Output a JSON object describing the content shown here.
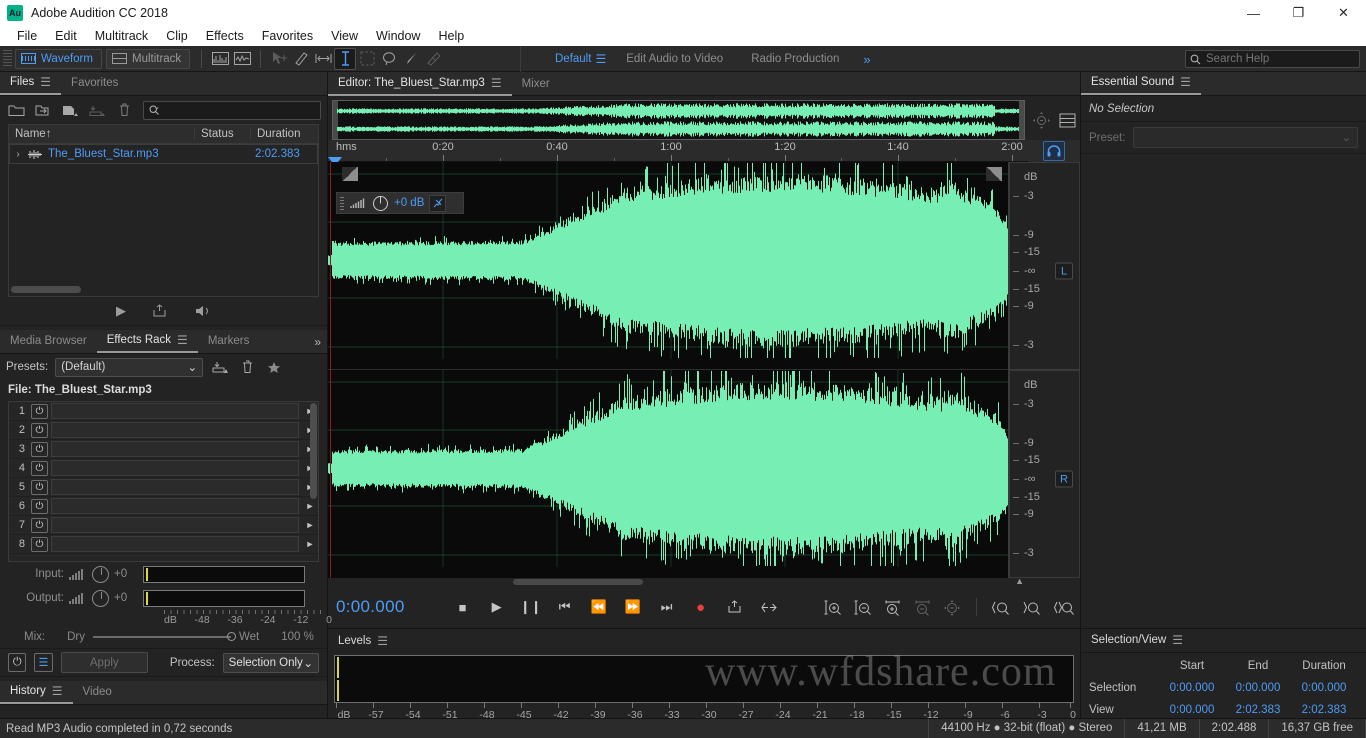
{
  "window": {
    "app_icon": "Au",
    "title": "Adobe Audition CC 2018",
    "minimize": "—",
    "maximize": "❐",
    "close": "✕"
  },
  "menubar": {
    "items": [
      "File",
      "Edit",
      "Multitrack",
      "Clip",
      "Effects",
      "Favorites",
      "View",
      "Window",
      "Help"
    ]
  },
  "toolbar": {
    "waveform_label": "Waveform",
    "multitrack_label": "Multitrack",
    "workspaces": [
      {
        "label": "Default",
        "active": true
      },
      {
        "label": "Edit Audio to Video",
        "active": false
      },
      {
        "label": "Radio Production",
        "active": false
      }
    ],
    "workspace_more": "»",
    "search_placeholder": "Search Help",
    "search_value": ""
  },
  "files_panel": {
    "tabs": [
      {
        "label": "Files",
        "active": true
      },
      {
        "label": "Favorites",
        "active": false
      }
    ],
    "search_placeholder": "",
    "search_value": "",
    "columns": {
      "name": "Name",
      "sort_arrow": "↑",
      "status": "Status",
      "duration": "Duration"
    },
    "rows": [
      {
        "expander": "›",
        "name": "The_Bluest_Star.mp3",
        "status": "",
        "duration": "2:02.383"
      }
    ],
    "transport": [
      "play-icon",
      "export-icon",
      "loop-play-icon"
    ]
  },
  "effects_panel": {
    "tabs": [
      {
        "label": "Media Browser",
        "active": false
      },
      {
        "label": "Effects Rack",
        "active": true
      },
      {
        "label": "Markers",
        "active": false
      }
    ],
    "more": "»",
    "presets_label": "Presets:",
    "presets_value": "(Default)",
    "file_label": "File: The_Bluest_Star.mp3",
    "slots": [
      "1",
      "2",
      "3",
      "4",
      "5",
      "6",
      "7",
      "8"
    ],
    "input_label": "Input:",
    "input_value": "+0",
    "output_label": "Output:",
    "output_value": "+0",
    "meter_scale": [
      "dB",
      "-48",
      "-36",
      "-24",
      "-12",
      "0"
    ],
    "mix_label": "Mix:",
    "mix_dry": "Dry",
    "mix_wet": "Wet",
    "mix_percent": "100 %",
    "apply_label": "Apply",
    "process_label": "Process:",
    "process_value": "Selection Only"
  },
  "history_panel": {
    "tabs": [
      {
        "label": "History",
        "active": true
      },
      {
        "label": "Video",
        "active": false
      }
    ]
  },
  "editor": {
    "tabs": [
      {
        "label": "Editor: The_Bluest_Star.mp3",
        "active": true
      },
      {
        "label": "Mixer",
        "active": false
      }
    ],
    "ruler_unit": "hms",
    "ruler_ticks": [
      "0:20",
      "0:40",
      "1:00",
      "1:20",
      "1:40",
      "2:00"
    ],
    "gain_value": "+0 dB",
    "db_scale_left": [
      "dB",
      "-3",
      "-9",
      "-15",
      "-∞",
      "-15",
      "-9",
      "-3"
    ],
    "db_scale_right": [
      "dB",
      "-3",
      "-9",
      "-15",
      "-∞",
      "-15",
      "-9",
      "-3"
    ],
    "channel_left_badge": "L",
    "channel_right_badge": "R",
    "time_display": "0:00.000",
    "transport_buttons": [
      "stop-icon",
      "play-icon",
      "pause-icon",
      "move-to-start-icon",
      "rewind-icon",
      "fast-forward-icon",
      "move-to-end-icon",
      "record-icon",
      "export-icon",
      "skip-selection-icon"
    ],
    "zoom_buttons": [
      "zoom-in-amplitude-icon",
      "zoom-out-amplitude-icon",
      "zoom-in-time-icon",
      "zoom-out-time-icon",
      "zoom-out-full-icon",
      "zoom-to-selection-left-icon",
      "zoom-to-selection-right-icon",
      "zoom-to-selection-icon",
      "zoom-in-vertical-icon"
    ]
  },
  "levels_panel": {
    "title": "Levels",
    "scale": [
      "dB",
      "-57",
      "-54",
      "-51",
      "-48",
      "-45",
      "-42",
      "-39",
      "-36",
      "-33",
      "-30",
      "-27",
      "-24",
      "-21",
      "-18",
      "-15",
      "-12",
      "-9",
      "-6",
      "-3",
      "0"
    ]
  },
  "essential_sound": {
    "title": "Essential Sound",
    "no_selection": "No Selection",
    "preset_label": "Preset:",
    "preset_value": ""
  },
  "selection_view": {
    "title": "Selection/View",
    "columns": [
      "",
      "Start",
      "End",
      "Duration"
    ],
    "rows": [
      {
        "label": "Selection",
        "start": "0:00.000",
        "end": "0:00.000",
        "duration": "0:00.000"
      },
      {
        "label": "View",
        "start": "0:00.000",
        "end": "2:02.383",
        "duration": "2:02.383"
      }
    ]
  },
  "statusbar": {
    "message": "Read MP3 Audio completed in 0,72 seconds",
    "sample_rate": "44100 Hz ● 32-bit (float) ● Stereo",
    "file_size": "41,21 MB",
    "duration": "2:02.488",
    "free_space": "16,37 GB free"
  },
  "watermark": {
    "text": "www.wfdshare.com"
  },
  "colors": {
    "accent_blue": "#4d9cf5",
    "waveform_green": "#77eeb4",
    "record_red": "#e8403a",
    "panel_bg": "#232323"
  }
}
